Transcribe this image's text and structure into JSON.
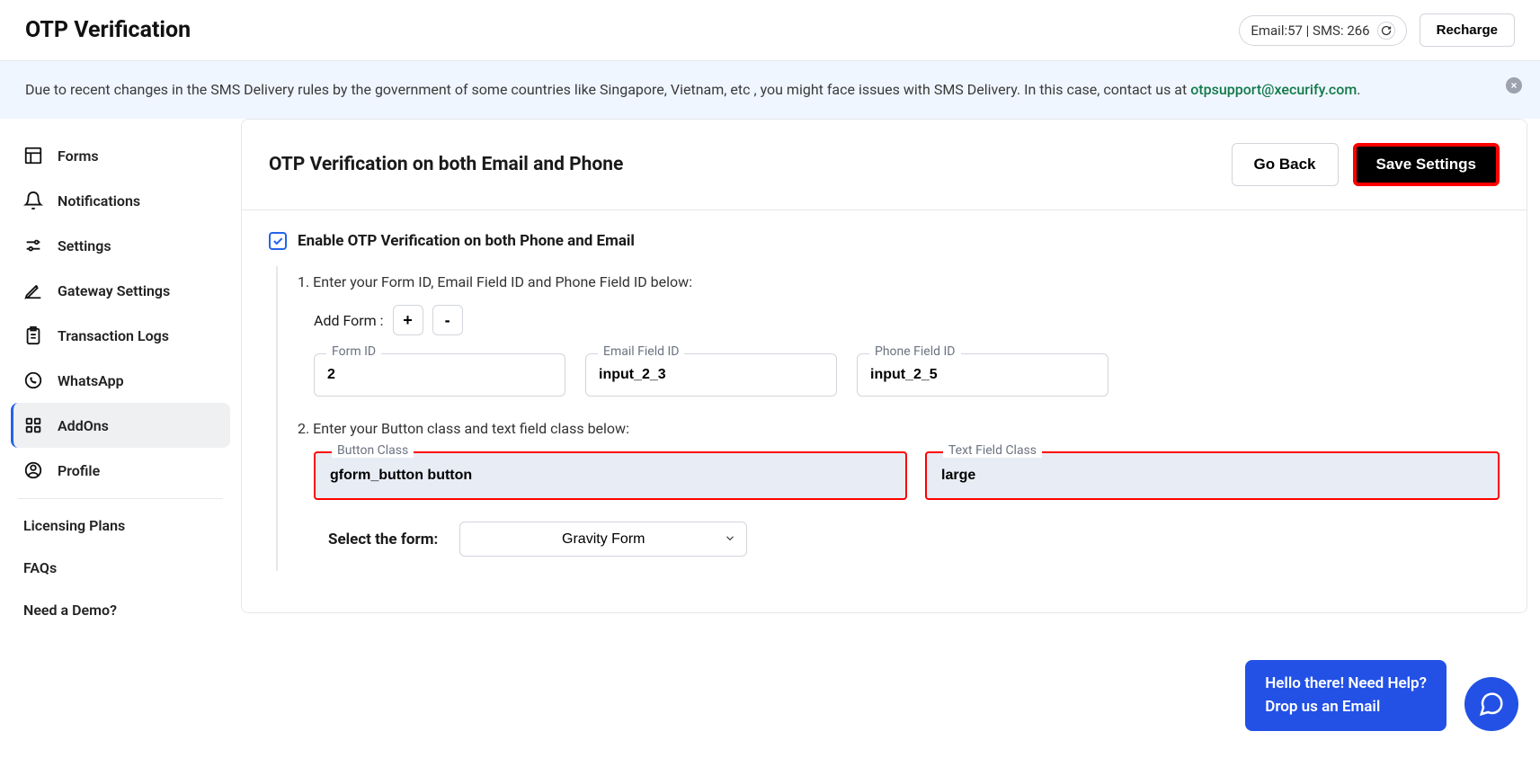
{
  "header": {
    "title": "OTP Verification",
    "usage": "Email:57 | SMS: 266",
    "recharge": "Recharge"
  },
  "notice": {
    "text": "Due to recent changes in the SMS Delivery rules by the government of some countries like Singapore, Vietnam, etc , you might face issues with SMS Delivery. In this case, contact us at ",
    "email": "otpsupport@xecurify.com",
    "dot": "."
  },
  "sidebar": {
    "items": [
      "Forms",
      "Notifications",
      "Settings",
      "Gateway Settings",
      "Transaction Logs",
      "WhatsApp",
      "AddOns",
      "Profile"
    ],
    "links": [
      "Licensing Plans",
      "FAQs",
      "Need a Demo?"
    ]
  },
  "card": {
    "title": "OTP Verification on both Email and Phone",
    "go_back": "Go Back",
    "save": "Save Settings",
    "enable_label": "Enable OTP Verification on both Phone and Email"
  },
  "step1": {
    "label": "1. Enter your Form ID, Email Field ID and Phone Field ID below:",
    "add_form": "Add Form :",
    "plus": "+",
    "minus": "-",
    "form_id_label": "Form ID",
    "form_id_value": "2",
    "email_id_label": "Email Field ID",
    "email_id_value": "input_2_3",
    "phone_id_label": "Phone Field ID",
    "phone_id_value": "input_2_5"
  },
  "step2": {
    "label": "2. Enter your Button class and text field class below:",
    "button_class_label": "Button Class",
    "button_class_value": "gform_button button",
    "text_class_label": "Text Field Class",
    "text_class_value": "large"
  },
  "select": {
    "label": "Select the form:",
    "value": "Gravity Form"
  },
  "help": {
    "line1": "Hello there! Need Help?",
    "line2": "Drop us an Email"
  }
}
